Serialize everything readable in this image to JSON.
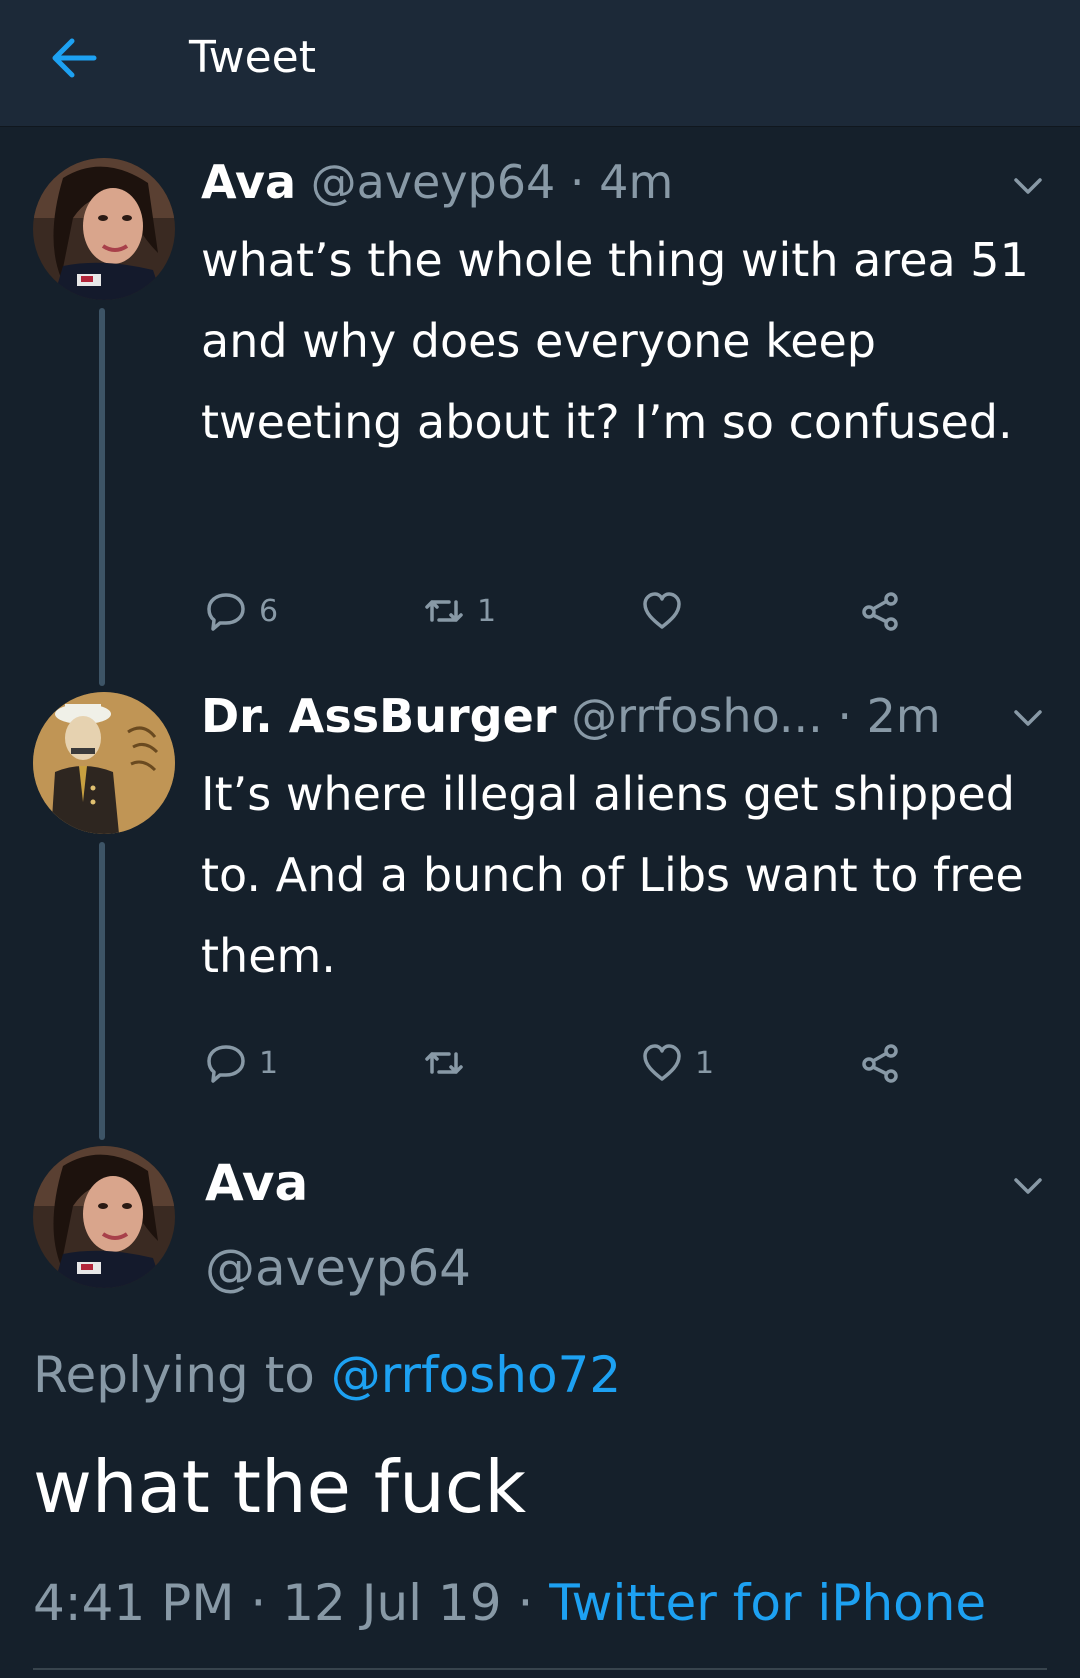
{
  "header": {
    "title": "Tweet",
    "back_icon": "arrow-left-icon"
  },
  "colors": {
    "background": "#15202b",
    "header": "#1c2938",
    "accent": "#1da1f2",
    "muted": "#8899a6",
    "thread_line": "#3d5466"
  },
  "tweets": [
    {
      "name": "Ava",
      "handle": "@aveyp64",
      "separator": "·",
      "time": "4m",
      "text": "what’s the whole thing with area 51 and why does everyone keep tweeting about it? I’m so confused.",
      "actions": {
        "reply_count": "6",
        "retweet_count": "1",
        "like_count": "",
        "share_count": ""
      }
    },
    {
      "name": "Dr. AssBurger",
      "handle": "@rrfosho...",
      "separator": "·",
      "time": "2m",
      "text": "It’s where illegal aliens get shipped to. And a bunch of Libs want to free them.",
      "actions": {
        "reply_count": "1",
        "retweet_count": "",
        "like_count": "1",
        "share_count": ""
      }
    }
  ],
  "main_tweet": {
    "name": "Ava",
    "handle": "@aveyp64",
    "replying_label": "Replying to",
    "replying_to": "@rrfosho72",
    "text": "what the fuck",
    "time": "4:41 PM",
    "separator": "·",
    "date": "12 Jul 19",
    "client": "Twitter for iPhone"
  }
}
